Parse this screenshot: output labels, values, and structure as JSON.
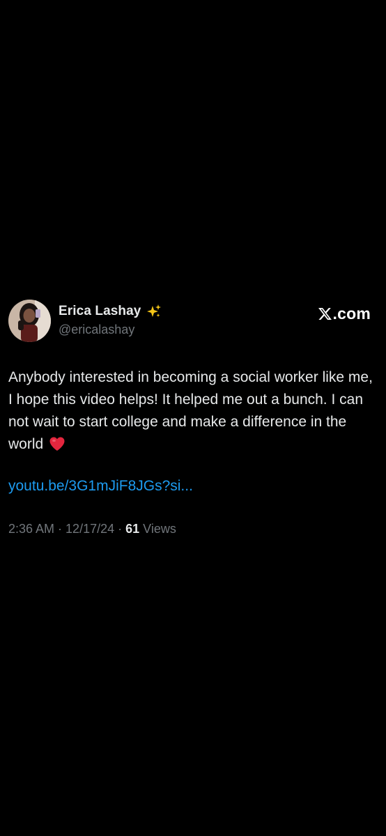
{
  "author": {
    "display_name": "Erica Lashay",
    "handle": "@ericalashay",
    "badge_icon": "sparkles-icon"
  },
  "brand": {
    "logo_icon": "x-logo-icon",
    "text": ".com"
  },
  "tweet": {
    "text": "Anybody interested in becoming a social worker like me, I hope this video helps! It helped me out a bunch. I can not wait to start college and make a difference in the world",
    "emoji_icon": "red-heart-icon",
    "link": "youtu.be/3G1mJiF8JGs?si...",
    "link_color": "#1d9bf0"
  },
  "meta": {
    "time": "2:36 AM",
    "separator": " · ",
    "date": "12/17/24",
    "views_count": "61",
    "views_label": " Views"
  },
  "colors": {
    "background": "#000000",
    "primary_text": "#e7e9ea",
    "secondary_text": "#71767b",
    "accent": "#1d9bf0"
  }
}
